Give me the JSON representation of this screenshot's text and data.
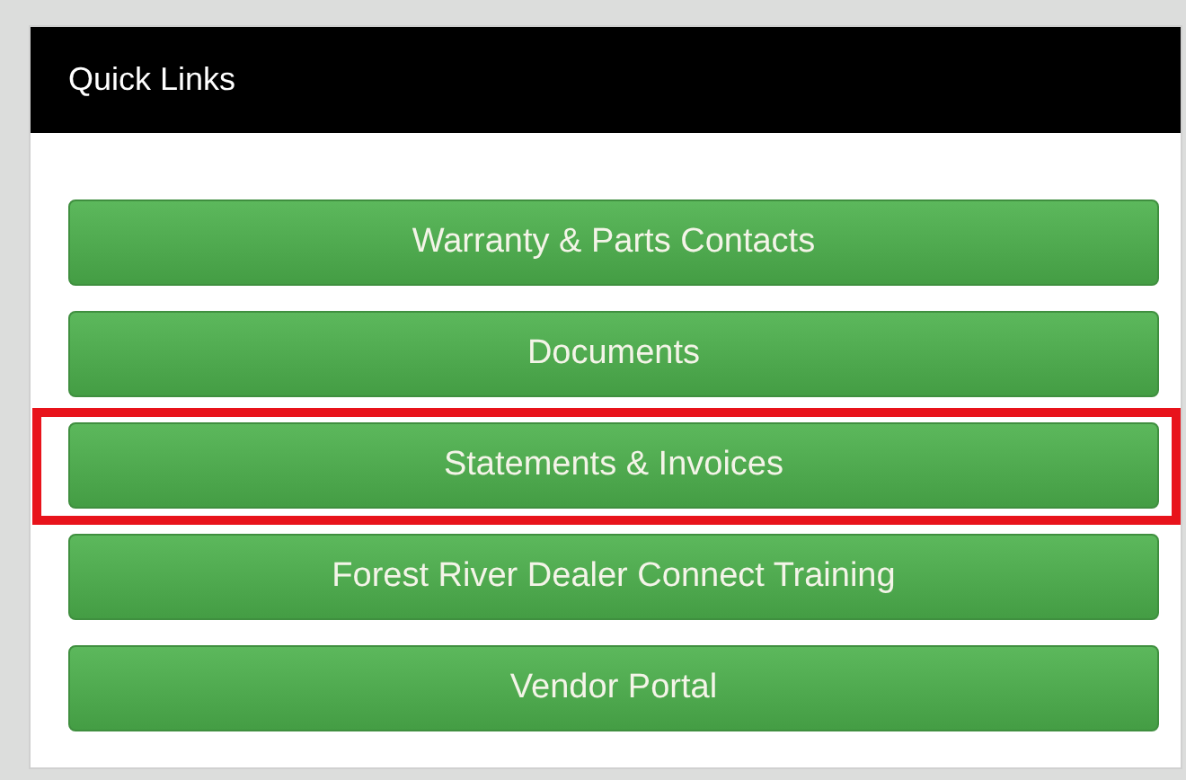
{
  "panel": {
    "title": "Quick Links"
  },
  "links": [
    {
      "label": "Warranty & Parts Contacts",
      "highlighted": false
    },
    {
      "label": "Documents",
      "highlighted": false
    },
    {
      "label": "Statements & Invoices",
      "highlighted": true
    },
    {
      "label": "Forest River Dealer Connect Training",
      "highlighted": false
    },
    {
      "label": "Vendor Portal",
      "highlighted": false
    }
  ]
}
